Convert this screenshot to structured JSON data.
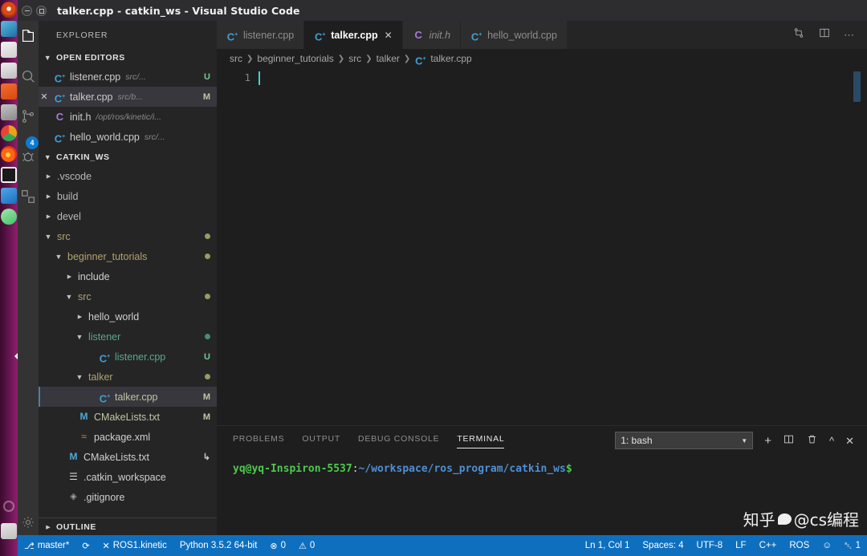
{
  "window": {
    "title": "talker.cpp - catkin_ws - Visual Studio Code",
    "minimize_icon": "minimize-icon",
    "maximize_icon": "maximize-icon"
  },
  "launcher": {
    "items": [
      {
        "name": "ubuntu-dash-icon"
      },
      {
        "name": "files-icon"
      },
      {
        "name": "libreoffice-writer-icon"
      },
      {
        "name": "libreoffice-calc-icon"
      },
      {
        "name": "ubuntu-software-icon"
      },
      {
        "name": "system-settings-icon"
      },
      {
        "name": "google-chrome-icon"
      },
      {
        "name": "firefox-icon"
      },
      {
        "name": "terminal-icon"
      },
      {
        "name": "vscode-icon"
      },
      {
        "name": "android-studio-icon"
      },
      {
        "name": "trash-icon"
      }
    ]
  },
  "activitybar": {
    "items": [
      {
        "name": "explorer-icon",
        "label": "Explorer"
      },
      {
        "name": "search-icon",
        "label": "Search"
      },
      {
        "name": "source-control-icon",
        "label": "Source Control"
      },
      {
        "name": "run-debug-icon",
        "label": "Run and Debug"
      },
      {
        "name": "extensions-icon",
        "label": "Extensions"
      }
    ],
    "badge": "4",
    "settings_icon": "gear-icon"
  },
  "sidebar": {
    "title": "EXPLORER",
    "open_editors": {
      "header": "OPEN EDITORS",
      "expanded": true,
      "items": [
        {
          "icon": "cpp-file-icon",
          "name": "listener.cpp",
          "desc": "src/...",
          "badge": "U",
          "badge_class": "b-U",
          "close": false,
          "state": ""
        },
        {
          "icon": "cpp-file-icon",
          "name": "talker.cpp",
          "desc": "src/b...",
          "badge": "M",
          "badge_class": "b-M",
          "close": true,
          "state": "selected"
        },
        {
          "icon": "h-file-icon",
          "name": "init.h",
          "desc": "/opt/ros/kinetic/i...",
          "badge": "",
          "badge_class": "",
          "close": false,
          "state": ""
        },
        {
          "icon": "cpp-file-icon",
          "name": "hello_world.cpp",
          "desc": "src/...",
          "badge": "",
          "badge_class": "",
          "close": false,
          "state": ""
        }
      ]
    },
    "workspace": {
      "header": "CATKIN_WS",
      "expanded": true,
      "tree": [
        {
          "indent": 0,
          "arrow": "right",
          "icon": "",
          "name": ".vscode",
          "color": "t-dim",
          "badge": "",
          "dot": ""
        },
        {
          "indent": 0,
          "arrow": "right",
          "icon": "",
          "name": "build",
          "color": "t-dim",
          "badge": "",
          "dot": ""
        },
        {
          "indent": 0,
          "arrow": "right",
          "icon": "",
          "name": "devel",
          "color": "t-dim",
          "badge": "",
          "dot": ""
        },
        {
          "indent": 0,
          "arrow": "down",
          "icon": "",
          "name": "src",
          "color": "t-olive",
          "badge": "",
          "dot": "olive"
        },
        {
          "indent": 1,
          "arrow": "down",
          "icon": "",
          "name": "beginner_tutorials",
          "color": "t-olive",
          "badge": "",
          "dot": "olive"
        },
        {
          "indent": 2,
          "arrow": "right",
          "icon": "",
          "name": "include",
          "color": "t-plain",
          "badge": "",
          "dot": ""
        },
        {
          "indent": 2,
          "arrow": "down",
          "icon": "",
          "name": "src",
          "color": "t-olive",
          "badge": "",
          "dot": "olive"
        },
        {
          "indent": 3,
          "arrow": "right",
          "icon": "",
          "name": "hello_world",
          "color": "t-plain",
          "badge": "",
          "dot": ""
        },
        {
          "indent": 3,
          "arrow": "down",
          "icon": "",
          "name": "listener",
          "color": "t-teal",
          "badge": "",
          "dot": "teal"
        },
        {
          "indent": 4,
          "arrow": "none",
          "icon": "cpp-file-icon",
          "name": "listener.cpp",
          "color": "t-teal",
          "badge": "U",
          "badge_class": "b-U",
          "dot": ""
        },
        {
          "indent": 3,
          "arrow": "down",
          "icon": "",
          "name": "talker",
          "color": "t-olive",
          "badge": "",
          "dot": "olive"
        },
        {
          "indent": 4,
          "arrow": "none",
          "icon": "cpp-file-icon",
          "name": "talker.cpp",
          "color": "t-mod",
          "badge": "M",
          "badge_class": "b-M",
          "dot": "",
          "state": "focused"
        },
        {
          "indent": 2,
          "arrow": "none",
          "icon": "cmake-file-icon",
          "name": "CMakeLists.txt",
          "color": "t-mod",
          "badge": "M",
          "badge_class": "b-M",
          "dot": ""
        },
        {
          "indent": 2,
          "arrow": "none",
          "icon": "xml-file-icon",
          "name": "package.xml",
          "color": "t-plain",
          "badge": "",
          "dot": ""
        },
        {
          "indent": 1,
          "arrow": "none",
          "icon": "cmake-file-icon",
          "name": "CMakeLists.txt",
          "color": "t-plain",
          "badge": "↳",
          "badge_class": "",
          "dot": ""
        },
        {
          "indent": 1,
          "arrow": "none",
          "icon": "txt-file-icon",
          "name": ".catkin_workspace",
          "color": "t-plain",
          "badge": "",
          "dot": ""
        },
        {
          "indent": 1,
          "arrow": "none",
          "icon": "git-file-icon",
          "name": ".gitignore",
          "color": "t-plain",
          "badge": "",
          "dot": ""
        }
      ]
    },
    "outline": {
      "header": "OUTLINE",
      "expanded": false
    }
  },
  "editor": {
    "tabs": [
      {
        "icon": "cpp-file-icon",
        "label": "listener.cpp",
        "active": false,
        "italic": false,
        "close": false
      },
      {
        "icon": "cpp-file-icon",
        "label": "talker.cpp",
        "active": true,
        "italic": false,
        "close": true
      },
      {
        "icon": "h-file-icon",
        "label": "init.h",
        "active": false,
        "italic": true,
        "close": false
      },
      {
        "icon": "cpp-file-icon",
        "label": "hello_world.cpp",
        "active": false,
        "italic": false,
        "close": false
      }
    ],
    "tab_actions": [
      {
        "name": "split-diff-icon"
      },
      {
        "name": "split-editor-icon"
      },
      {
        "name": "more-actions-icon"
      }
    ],
    "breadcrumb": [
      "src",
      "beginner_tutorials",
      "src",
      "talker",
      "talker.cpp"
    ],
    "breadcrumb_file_icon": "cpp-file-icon",
    "line_number": "1",
    "content": ""
  },
  "panel": {
    "tabs": [
      {
        "label": "PROBLEMS",
        "active": false
      },
      {
        "label": "OUTPUT",
        "active": false
      },
      {
        "label": "DEBUG CONSOLE",
        "active": false
      },
      {
        "label": "TERMINAL",
        "active": true
      }
    ],
    "terminal_select": "1: bash",
    "actions": [
      {
        "name": "new-terminal-icon",
        "glyph": "+"
      },
      {
        "name": "split-terminal-icon",
        "glyph": "◫"
      },
      {
        "name": "kill-terminal-icon",
        "glyph": "Ὕ1"
      },
      {
        "name": "maximize-panel-icon",
        "glyph": "∧"
      },
      {
        "name": "close-panel-icon",
        "glyph": "✕"
      }
    ],
    "terminal": {
      "user_host": "yq@yq-Inspiron-5537",
      "colon": ":",
      "path": "~/workspace/ros_program/catkin_ws",
      "prompt": "$"
    }
  },
  "watermark": {
    "text_left": "知乎",
    "text_right": "@cs编程"
  },
  "statusbar": {
    "left": [
      {
        "name": "branch",
        "icon": "⎇",
        "label": "master*"
      },
      {
        "name": "sync",
        "icon": "⟳",
        "label": ""
      },
      {
        "name": "ros-distro",
        "icon": "✕",
        "label": "ROS1.kinetic"
      },
      {
        "name": "python-version",
        "icon": "",
        "label": "Python 3.5.2 64-bit"
      },
      {
        "name": "problems",
        "icon": "⊗",
        "label": "0"
      },
      {
        "name": "warnings",
        "icon": "⚠",
        "label": "0"
      }
    ],
    "right": [
      {
        "name": "cursor-position",
        "label": "Ln 1, Col 1"
      },
      {
        "name": "indentation",
        "label": "Spaces: 4"
      },
      {
        "name": "encoding",
        "label": "UTF-8"
      },
      {
        "name": "eol",
        "label": "LF"
      },
      {
        "name": "language-mode",
        "label": "C++"
      },
      {
        "name": "ros-status",
        "label": "ROS"
      },
      {
        "name": "feedback-smiley",
        "label": "☺"
      },
      {
        "name": "notifications",
        "label": "1"
      }
    ]
  },
  "colors": {
    "accent": "#0e6fbf",
    "sidebar_bg": "#252526",
    "editor_bg": "#1e1e1e",
    "titlebar_bg": "#2d2d30",
    "modified": "#c3c3a4",
    "untracked": "#73c991"
  }
}
